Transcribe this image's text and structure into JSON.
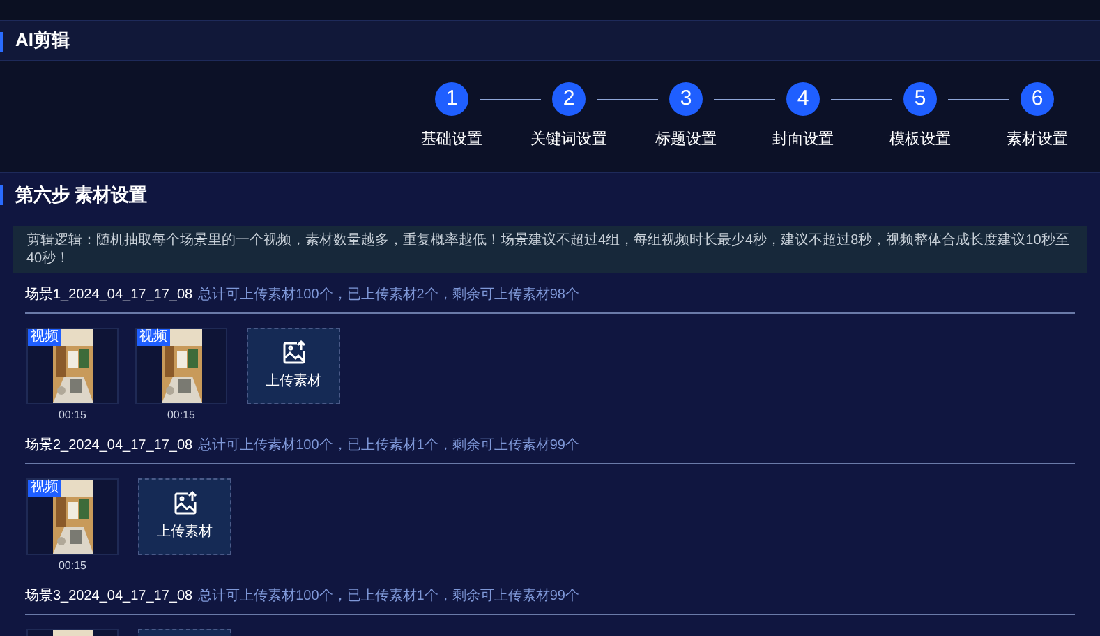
{
  "header": {
    "title": "AI剪辑"
  },
  "steps": [
    {
      "number": "1",
      "label": "基础设置"
    },
    {
      "number": "2",
      "label": "关键词设置"
    },
    {
      "number": "3",
      "label": "标题设置"
    },
    {
      "number": "4",
      "label": "封面设置"
    },
    {
      "number": "5",
      "label": "模板设置"
    },
    {
      "number": "6",
      "label": "素材设置"
    }
  ],
  "section": {
    "title": "第六步 素材设置"
  },
  "notice": "剪辑逻辑：随机抽取每个场景里的一个视频，素材数量越多，重复概率越低！场景建议不超过4组，每组视频时长最少4秒，建议不超过8秒，视频整体合成长度建议10秒至40秒！",
  "scenes": [
    {
      "name": "场景1_2024_04_17_17_08",
      "info": "总计可上传素材100个，已上传素材2个，剩余可上传素材98个",
      "items": [
        {
          "kind": "video",
          "badge": "视频",
          "duration": "00:15"
        },
        {
          "kind": "video",
          "badge": "视频",
          "duration": "00:15"
        },
        {
          "kind": "upload",
          "label": "上传素材"
        }
      ]
    },
    {
      "name": "场景2_2024_04_17_17_08",
      "info": "总计可上传素材100个，已上传素材1个，剩余可上传素材99个",
      "items": [
        {
          "kind": "video",
          "badge": "视频",
          "duration": "00:15"
        },
        {
          "kind": "upload",
          "label": "上传素材"
        }
      ]
    },
    {
      "name": "场景3_2024_04_17_17_08",
      "info": "总计可上传素材100个，已上传素材1个，剩余可上传素材99个",
      "items": [
        {
          "kind": "video"
        },
        {
          "kind": "upload"
        }
      ]
    }
  ]
}
